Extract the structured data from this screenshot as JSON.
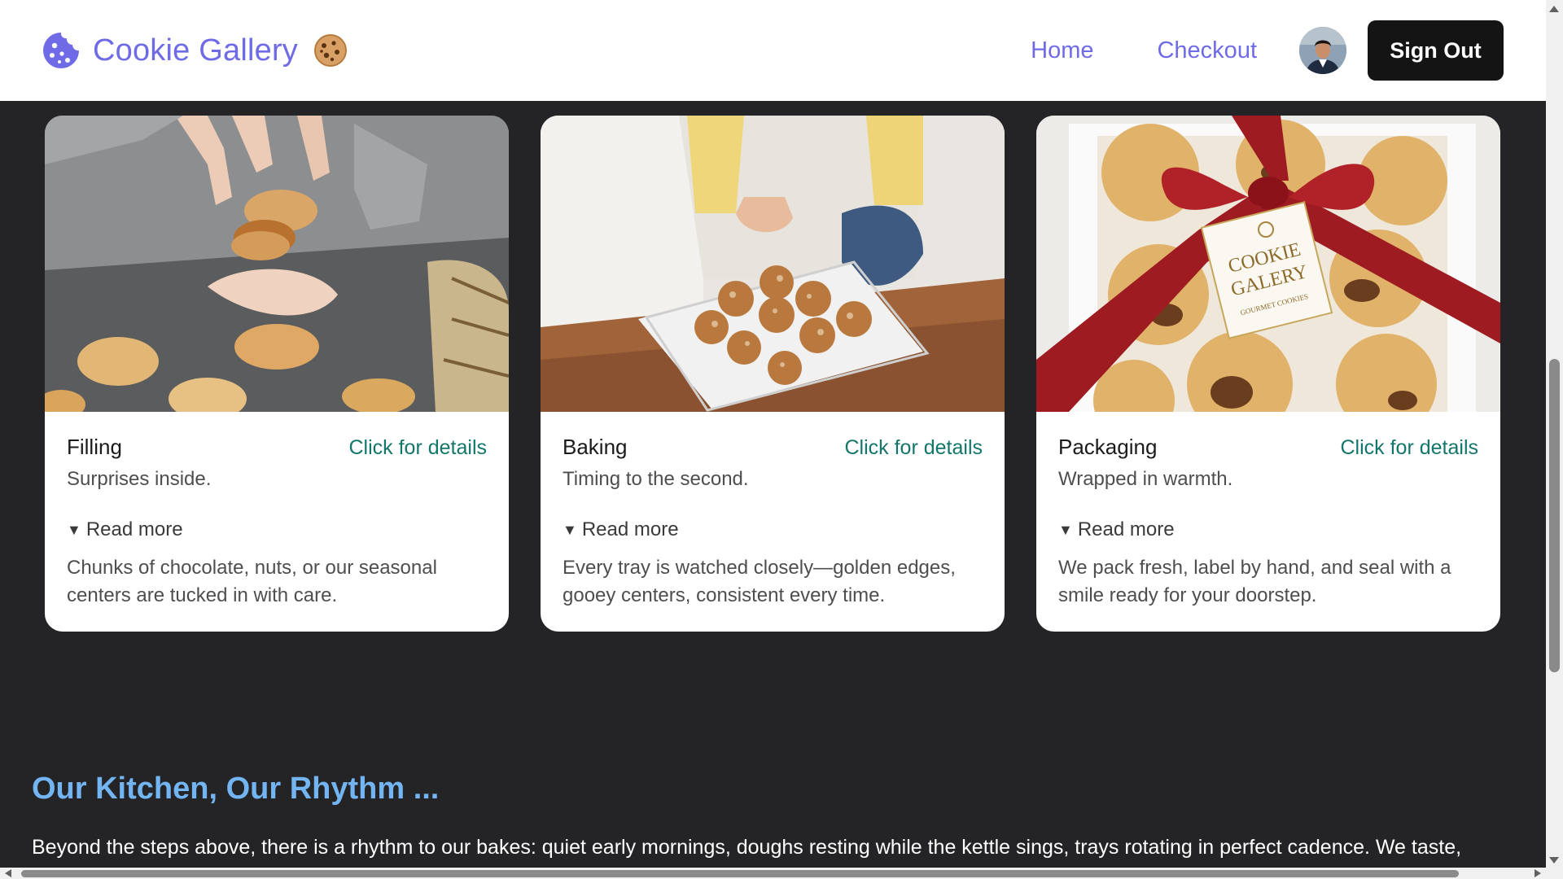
{
  "header": {
    "brand_name": "Cookie Gallery",
    "nav": [
      {
        "label": "Home"
      },
      {
        "label": "Checkout"
      }
    ],
    "signout_label": "Sign Out"
  },
  "cards": [
    {
      "title": "Filling",
      "link": "Click for details",
      "subtitle": "Surprises inside.",
      "read_more": "Read more",
      "description": "Chunks of chocolate, nuts, or our seasonal centers are tucked in with care."
    },
    {
      "title": "Baking",
      "link": "Click for details",
      "subtitle": "Timing to the second.",
      "read_more": "Read more",
      "description": "Every tray is watched closely—golden edges, gooey centers, consistent every time."
    },
    {
      "title": "Packaging",
      "link": "Click for details",
      "subtitle": "Wrapped in warmth.",
      "read_more": "Read more",
      "description": "We pack fresh, label by hand, and seal with a smile ready for your doorstep.",
      "image_label_line1": "COOKIE",
      "image_label_line2": "GALERY",
      "image_label_line3": "GOURMET COOKIES"
    }
  ],
  "section": {
    "title": "Our Kitchen, Our Rhythm ...",
    "text": "Beyond the steps above, there is a rhythm to our bakes: quiet early mornings, doughs resting while the kettle sings, trays rotating in perfect cadence. We taste,"
  },
  "colors": {
    "brand": "#6f6be6",
    "link_green": "#13766a",
    "section_title": "#73b4f2",
    "page_bg": "#242426"
  },
  "icons": {
    "brand": "cookie-icon",
    "brand_emoji": "cookie-emoji-icon",
    "read_more": "triangle-down-icon"
  }
}
